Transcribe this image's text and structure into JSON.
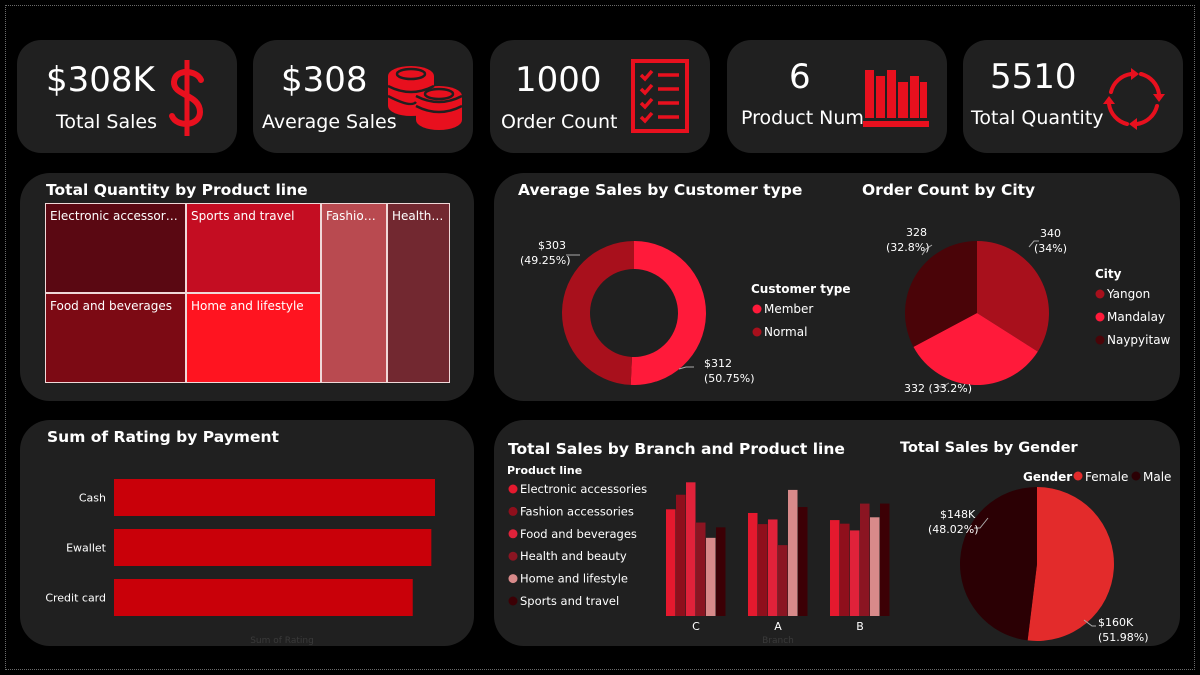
{
  "kpis": {
    "total_sales": {
      "value": "$308K",
      "label": "Total Sales"
    },
    "average_sales": {
      "value": "$308",
      "label": "Average Sales"
    },
    "order_count": {
      "value": "1000",
      "label": "Order Count"
    },
    "product_num": {
      "value": "6",
      "label": "Product Num"
    },
    "total_quantity": {
      "value": "5510",
      "label": "Total Quantity"
    }
  },
  "icons": {
    "total_sales": "dollar-sign-icon",
    "average_sales": "coins-stack-icon",
    "order_count": "checklist-icon",
    "product_num": "books-icon",
    "total_quantity": "refresh-cycle-icon"
  },
  "colors": {
    "accent": "#e8101e",
    "card_bg": "#202020",
    "page_bg": "#000000"
  },
  "chart_data": [
    {
      "type": "treemap",
      "title": "Total Quantity by Product line",
      "items": [
        {
          "label": "Electronic accessories",
          "color": "#5a0812"
        },
        {
          "label": "Sports and travel",
          "color": "#c40d22"
        },
        {
          "label": "Fashion ...",
          "color": "#b94a50"
        },
        {
          "label": "Health ...",
          "color": "#722830"
        },
        {
          "label": "Food and beverages",
          "color": "#7c0a14"
        },
        {
          "label": "Home and lifestyle",
          "color": "#ff1420"
        }
      ]
    },
    {
      "type": "donut",
      "title": "Average Sales by Customer type",
      "legend_title": "Customer type",
      "slices": [
        {
          "name": "Member",
          "value": 312,
          "label": "$312",
          "pct": "(50.75%)",
          "color": "#ff1a3a"
        },
        {
          "name": "Normal",
          "value": 303,
          "label": "$303",
          "pct": "(49.25%)",
          "color": "#a8101c"
        }
      ]
    },
    {
      "type": "pie",
      "title": "Order Count by City",
      "legend_title": "City",
      "slices": [
        {
          "name": "Yangon",
          "value": 340,
          "label": "340",
          "pct": "(34%)",
          "color": "#a8101c"
        },
        {
          "name": "Mandalay",
          "value": 332,
          "label": "332 (33.2%)",
          "pct": "",
          "color": "#ff1a3a"
        },
        {
          "name": "Naypyitaw",
          "value": 328,
          "label": "328",
          "pct": "(32.8%)",
          "color": "#4a0408"
        }
      ]
    },
    {
      "type": "bar",
      "orientation": "horizontal",
      "title": "Sum of Rating by Payment",
      "xlabel": "Sum of Rating",
      "categories": [
        "Cash",
        "Ewallet",
        "Credit card"
      ],
      "values": [
        2365,
        2338,
        2201
      ],
      "xlim": [
        0,
        2365
      ],
      "color": "#c90009"
    },
    {
      "type": "bar",
      "title": "Total Sales by Branch and Product line",
      "xlabel": "Branch",
      "legend_title": "Product line",
      "categories": [
        "C",
        "A",
        "B"
      ],
      "ylim": [
        0,
        24000
      ],
      "series": [
        {
          "name": "Electronic accessories",
          "color": "#e5192e",
          "values": [
            18968,
            18317,
            17051
          ]
        },
        {
          "name": "Fashion accessories",
          "color": "#8f0f1c",
          "values": [
            21560,
            16333,
            16413
          ]
        },
        {
          "name": "Food and beverages",
          "color": "#e0223a",
          "values": [
            23767,
            17163,
            15215
          ]
        },
        {
          "name": "Health and beauty",
          "color": "#8b1522",
          "values": [
            16615,
            12597,
            19980
          ]
        },
        {
          "name": "Home and lifestyle",
          "color": "#d88a8a",
          "values": [
            13896,
            22417,
            17549
          ]
        },
        {
          "name": "Sports and travel",
          "color": "#3c0005",
          "values": [
            15761,
            19372,
            19988
          ]
        }
      ]
    },
    {
      "type": "pie",
      "title": "Total Sales by Gender",
      "legend_title": "Gender",
      "slices": [
        {
          "name": "Female",
          "value": 160,
          "label": "$160K",
          "pct": "(51.98%)",
          "color": "#e32b2b"
        },
        {
          "name": "Male",
          "value": 148,
          "label": "$148K",
          "pct": "(48.02%)",
          "color": "#2b0004"
        }
      ]
    }
  ]
}
